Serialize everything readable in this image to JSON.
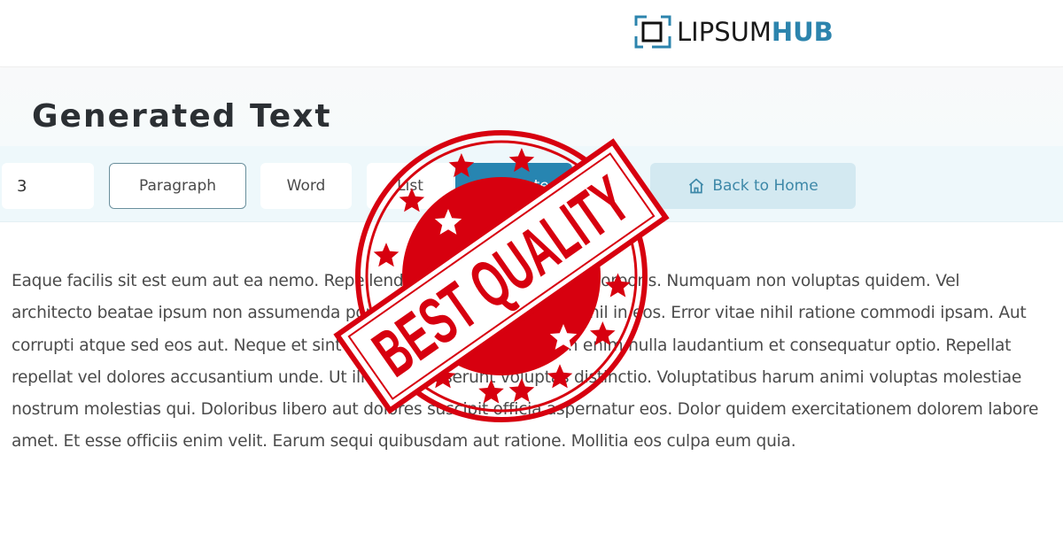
{
  "header": {
    "logo": {
      "icon": "logo-squares-icon",
      "text_part1": "LIPSUM",
      "text_part2": "HUB",
      "brand_color": "#2c84ad"
    }
  },
  "page": {
    "title": "Generated Text"
  },
  "toolbar": {
    "count_value": "3",
    "paragraph_label": "Paragraph",
    "word_label": "Word",
    "list_label": "List",
    "generate_label": "Generate",
    "generate_label_note": "label obscured by overlay",
    "home_label": "Back to Home",
    "home_icon": "house-icon",
    "selected_type": "Paragraph",
    "accent_color": "#2785b1"
  },
  "content": {
    "paragraph": "Eaque facilis sit est eum aut ea nemo. Repellendus aut velit laboriosam corporis. Numquam non voluptas quidem. Vel architecto beatae ipsum non assumenda porro veritatis. Laborum qui nihil in eos. Error vitae nihil ratione commodi ipsam. Aut corrupti atque sed eos aut. Neque et sint quos alias rerum voluptatem enim nulla laudantium et consequatur optio. Repellat repellat vel dolores accusantium unde. Ut illo iusto deserunt voluptas distinctio. Voluptatibus harum animi voluptas molestiae nostrum molestias qui. Doloribus libero aut dolores suscipit officia aspernatur eos. Dolor quidem exercitationem dolorem labore amet. Et esse officiis enim velit. Earum sequi quibusdam aut ratione. Mollitia eos culpa eum quia."
  },
  "overlay": {
    "stamp_text": "BEST QUALITY",
    "stamp_color": "#d7000f",
    "stars": "star-icon"
  }
}
